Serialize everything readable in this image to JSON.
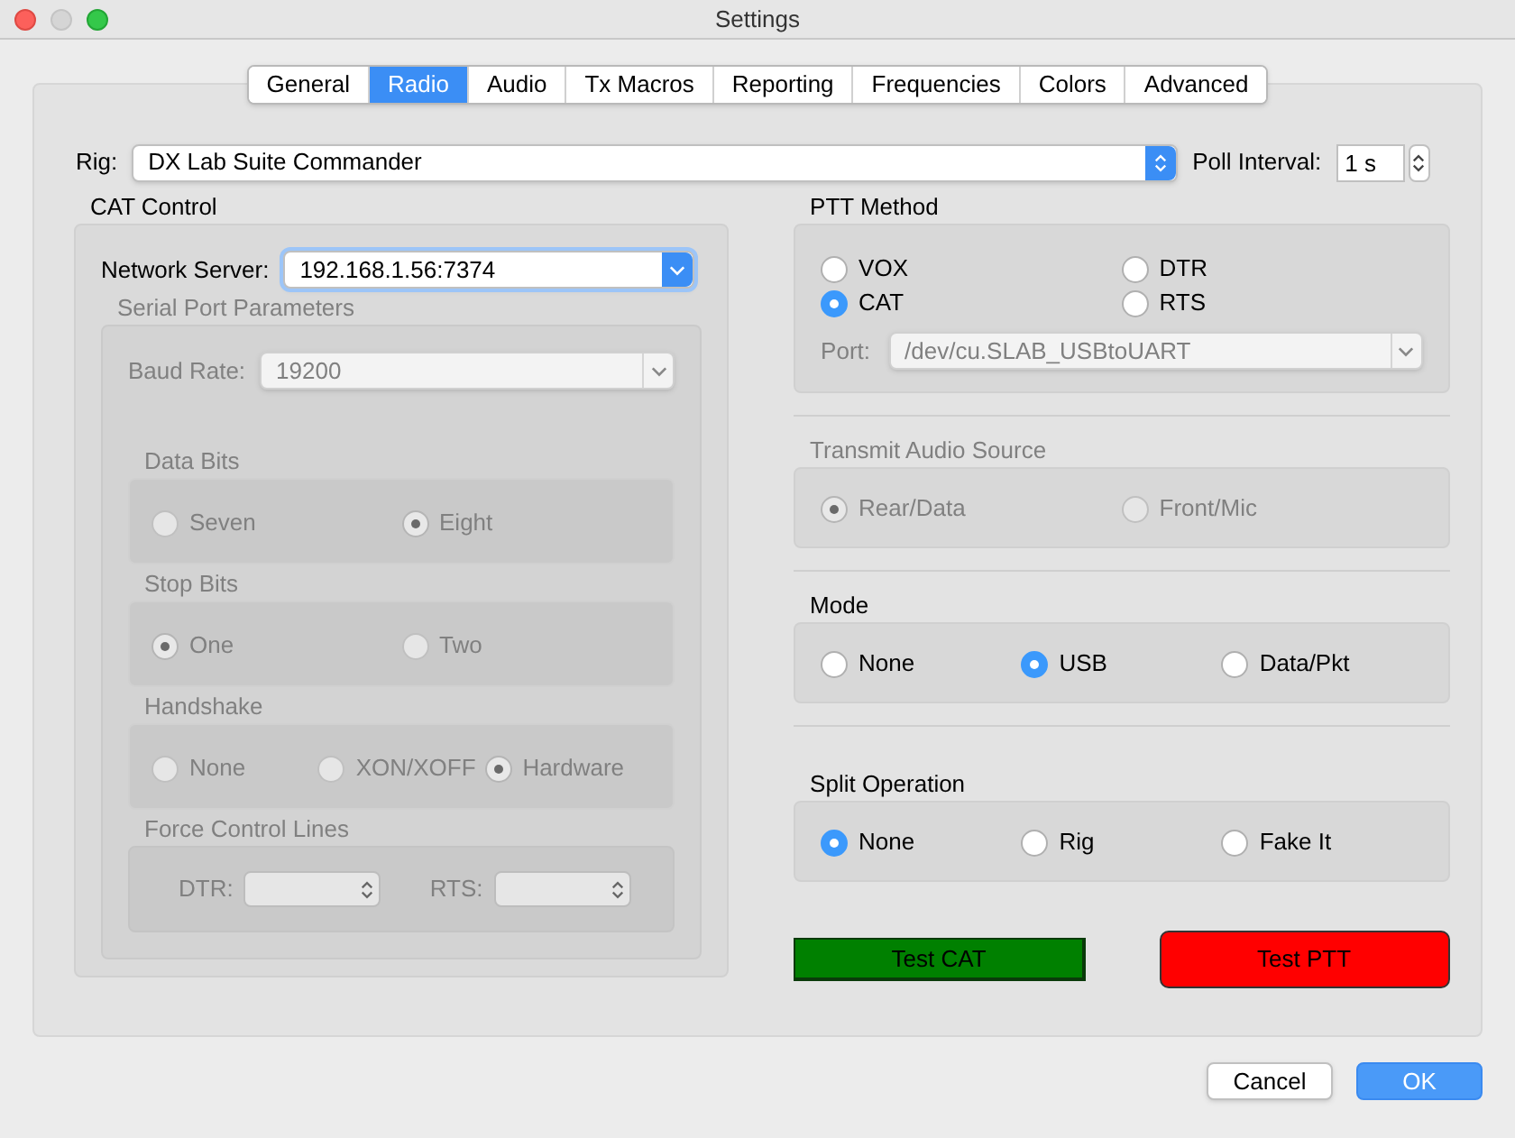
{
  "window": {
    "title": "Settings"
  },
  "tabs": [
    {
      "label": "General",
      "selected": false
    },
    {
      "label": "Radio",
      "selected": true
    },
    {
      "label": "Audio",
      "selected": false
    },
    {
      "label": "Tx Macros",
      "selected": false
    },
    {
      "label": "Reporting",
      "selected": false
    },
    {
      "label": "Frequencies",
      "selected": false
    },
    {
      "label": "Colors",
      "selected": false
    },
    {
      "label": "Advanced",
      "selected": false
    }
  ],
  "rig": {
    "label": "Rig:",
    "value": "DX Lab Suite Commander"
  },
  "poll_interval": {
    "label": "Poll Interval:",
    "value": "1 s"
  },
  "cat_control": {
    "title": "CAT Control",
    "network_server": {
      "label": "Network Server:",
      "value": "192.168.1.56:7374"
    },
    "serial_port": {
      "title": "Serial Port Parameters",
      "disabled": true,
      "baud_rate": {
        "label": "Baud Rate:",
        "value": "19200"
      },
      "groups": [
        {
          "title": "Data Bits",
          "options": [
            {
              "label": "Seven",
              "selected": false
            },
            {
              "label": "Eight",
              "selected": true
            }
          ]
        },
        {
          "title": "Stop Bits",
          "options": [
            {
              "label": "One",
              "selected": true
            },
            {
              "label": "Two",
              "selected": false
            }
          ]
        },
        {
          "title": "Handshake",
          "options": [
            {
              "label": "None",
              "selected": false
            },
            {
              "label": "XON/XOFF",
              "selected": false
            },
            {
              "label": "Hardware",
              "selected": true
            }
          ]
        }
      ],
      "force_control_lines": {
        "title": "Force Control Lines",
        "dtr_label": "DTR:",
        "rts_label": "RTS:"
      }
    }
  },
  "ptt_method": {
    "title": "PTT Method",
    "disabled": false,
    "options": [
      {
        "label": "VOX",
        "selected": false
      },
      {
        "label": "DTR",
        "selected": false
      },
      {
        "label": "CAT",
        "selected": true
      },
      {
        "label": "RTS",
        "selected": false
      }
    ],
    "port": {
      "label": "Port:",
      "value": "/dev/cu.SLAB_USBtoUART",
      "disabled": true
    }
  },
  "transmit_audio_source": {
    "title": "Transmit Audio Source",
    "disabled": true,
    "options": [
      {
        "label": "Rear/Data",
        "selected": true
      },
      {
        "label": "Front/Mic",
        "selected": false
      }
    ]
  },
  "mode": {
    "title": "Mode",
    "disabled": false,
    "options": [
      {
        "label": "None",
        "selected": false
      },
      {
        "label": "USB",
        "selected": true
      },
      {
        "label": "Data/Pkt",
        "selected": false
      }
    ]
  },
  "split_operation": {
    "title": "Split Operation",
    "disabled": false,
    "options": [
      {
        "label": "None",
        "selected": true
      },
      {
        "label": "Rig",
        "selected": false
      },
      {
        "label": "Fake It",
        "selected": false
      }
    ]
  },
  "test_buttons": [
    {
      "label": "Test CAT",
      "color": "#008000"
    },
    {
      "label": "Test PTT",
      "color": "#ff0000"
    }
  ],
  "buttons": [
    {
      "label": "Cancel",
      "default": false
    },
    {
      "label": "OK",
      "default": true
    }
  ]
}
